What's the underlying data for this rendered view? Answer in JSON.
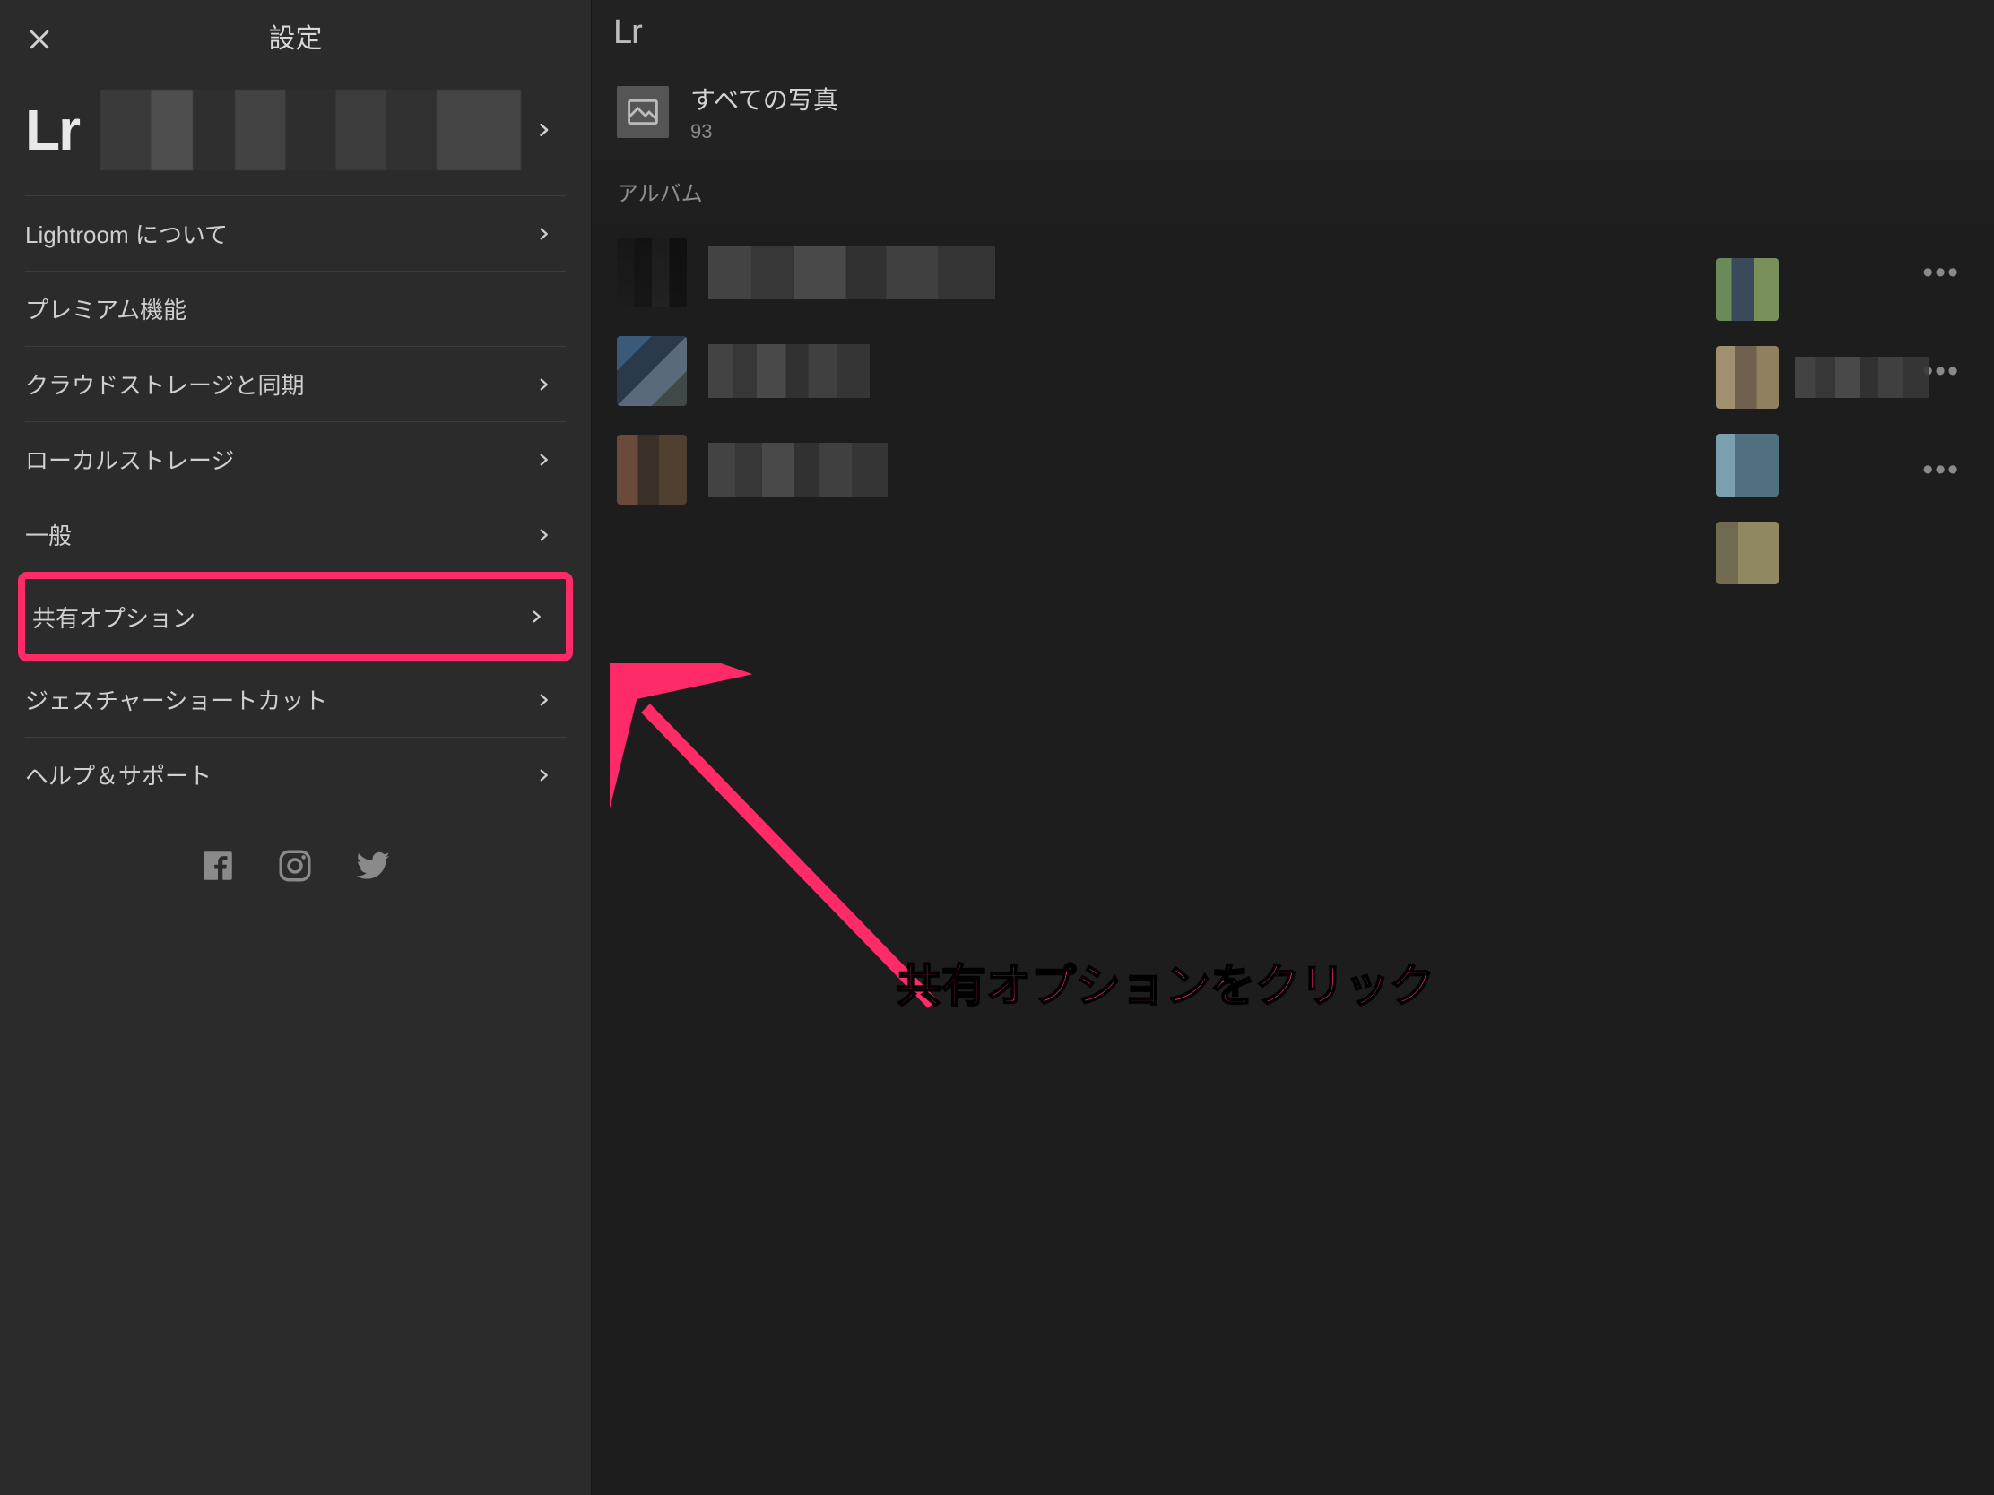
{
  "settings": {
    "title": "設定",
    "items": [
      {
        "label": "Lightroom について",
        "chevron": true
      },
      {
        "label": "プレミアム機能",
        "chevron": false
      },
      {
        "label": "クラウドストレージと同期",
        "chevron": true
      },
      {
        "label": "ローカルストレージ",
        "chevron": true
      },
      {
        "label": "一般",
        "chevron": true
      },
      {
        "label": "共有オプション",
        "chevron": true,
        "highlighted": true
      },
      {
        "label": "ジェスチャーショートカット",
        "chevron": true
      },
      {
        "label": "ヘルプ＆サポート",
        "chevron": true
      }
    ]
  },
  "brand": {
    "logo_text": "Lr",
    "header_logo_text": "Lr"
  },
  "library": {
    "all_photos_label": "すべての写真",
    "all_photos_count": "93",
    "albums_header": "アルバム"
  },
  "annotation": {
    "text": "共有オプションをクリック",
    "color": "#ff2a68"
  }
}
